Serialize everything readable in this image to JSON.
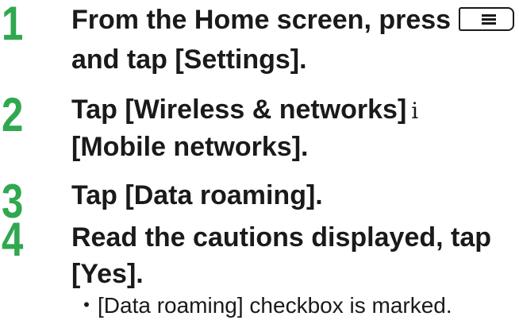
{
  "steps": [
    {
      "number": "1",
      "lines": [
        "From the Home screen, press",
        "and tap [Settings]."
      ],
      "key_icon": "menu-key-icon"
    },
    {
      "number": "2",
      "lines": [
        "Tap [Wireless & networks]",
        "[Mobile networks]."
      ],
      "separator": "i"
    },
    {
      "number": "3",
      "lines": [
        "Tap [Data roaming]."
      ]
    },
    {
      "number": "4",
      "lines": [
        "Read the cautions displayed, tap",
        "[Yes]."
      ],
      "note_bullet": "・",
      "note": "[Data roaming] checkbox is marked."
    }
  ],
  "colors": {
    "step_number": "#2fa84f",
    "text": "#1a1a1a"
  }
}
